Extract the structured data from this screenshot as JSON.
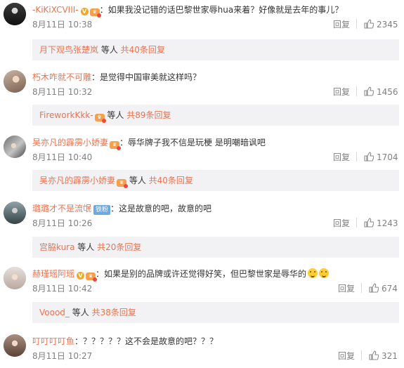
{
  "ui": {
    "reply_label": "回复",
    "like_color": "#808080",
    "accent": "#eb7350"
  },
  "comments": [
    {
      "user": "-KiKiXCVIII-",
      "badges": [
        "vip-v",
        "crown"
      ],
      "text": "：如果我没记错的话巴黎世家辱hua来着？好像就是去年的事儿？",
      "time": "8月11日 10:38",
      "likes": "2345",
      "sub": {
        "names": "月下观鸟张楚岚",
        "suffix": " 等人 ",
        "count": "共40条回复"
      }
    },
    {
      "user": "朽木咋就不可雕",
      "badges": [],
      "text": "：是觉得中国审美就这样吗？",
      "time": "8月11日 10:32",
      "likes": "1456",
      "sub": {
        "names": "FireworkKkk-",
        "suffix": " 等人 ",
        "count": "共89条回复"
      }
    },
    {
      "user": "吴亦凡的霹雳小娇妻",
      "badges": [
        "crown"
      ],
      "text": "：辱华牌子我不信是玩梗  是明嘲暗讽吧",
      "time": "8月11日 10:40",
      "likes": "1704",
      "sub": {
        "names": "吴亦凡的霹雳小娇妻",
        "suffix": " 等人 ",
        "count": "共40条回复"
      }
    },
    {
      "user": "璐璐才不是流氓",
      "badges": [
        "fan"
      ],
      "fan_badge": "铁粉",
      "text": "：这是故意的吧，故意的吧",
      "time": "8月11日 10:26",
      "likes": "1243",
      "sub": {
        "names": "宫脇kura",
        "suffix": " 等人 ",
        "count": "共20条回复"
      }
    },
    {
      "user": "赫瑾瑶阿瑶",
      "badges": [
        "vip-v",
        "crown"
      ],
      "text": "：如果是别的品牌或许还觉得好笑，但巴黎世家是辱华的",
      "time": "8月11日 10:42",
      "likes": "674",
      "sub": {
        "names": "Voood_",
        "suffix": " 等人 ",
        "count": "共38条回复"
      }
    },
    {
      "user": "叮叮叮叮鱼",
      "badges": [],
      "text": "：？？？？？这不会是故意的吧？？？",
      "time": "8月11日 10:27",
      "likes": "321"
    }
  ]
}
